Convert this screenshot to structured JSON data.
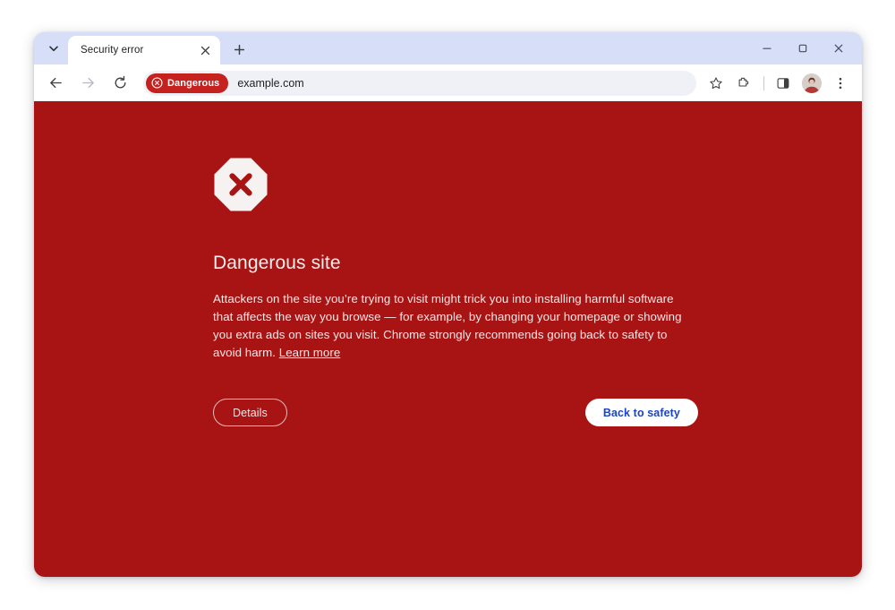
{
  "window": {
    "tab_search_icon": "chevron-down-icon",
    "tabs": [
      {
        "title": "Security error",
        "close_icon": "close-icon"
      }
    ],
    "new_tab_icon": "plus-icon",
    "controls": {
      "minimize_icon": "minimize-icon",
      "maximize_icon": "maximize-icon",
      "close_icon": "close-icon"
    }
  },
  "toolbar": {
    "back_icon": "back-arrow-icon",
    "forward_icon": "forward-arrow-icon",
    "reload_icon": "reload-icon",
    "security_chip": {
      "icon": "circle-x-icon",
      "label": "Dangerous",
      "color": "#c5221f"
    },
    "url": "example.com",
    "bookmark_icon": "star-icon",
    "extensions_icon": "puzzle-icon",
    "side_panel_icon": "side-panel-icon",
    "avatar_icon": "profile-avatar",
    "menu_icon": "three-dot-menu-icon"
  },
  "interstitial": {
    "background_color": "#a81414",
    "warning_icon": "octagon-x-icon",
    "heading": "Dangerous site",
    "body_part1": "Attackers on the site you’re trying to visit might trick you into installing harmful software that affects the way you browse — for example, by changing your homepage or showing you extra ads on sites you visit. Chrome strongly recommends going back to safety to avoid harm. ",
    "learn_more_label": "Learn more",
    "details_button": "Details",
    "back_to_safety_button": "Back to safety",
    "back_to_safety_text_color": "#1a45c4"
  }
}
